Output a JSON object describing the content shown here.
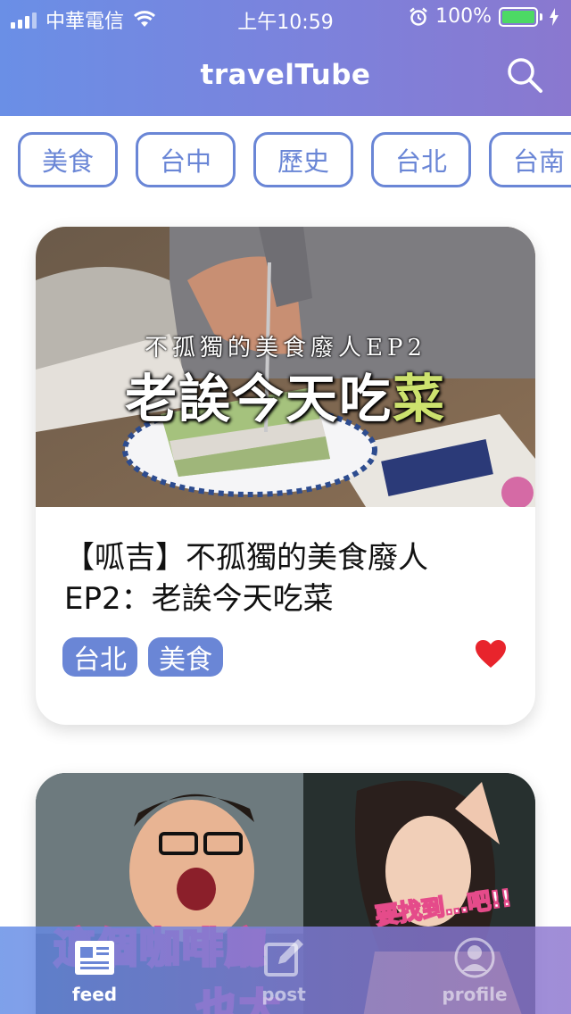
{
  "status_bar": {
    "carrier": "中華電信",
    "time": "上午10:59",
    "battery": "100%",
    "battery_level": 1.0
  },
  "header": {
    "title": "travelTube",
    "search_icon": "search-icon"
  },
  "chips": [
    {
      "label": "美食"
    },
    {
      "label": "台中"
    },
    {
      "label": "歷史"
    },
    {
      "label": "台北"
    },
    {
      "label": "台南"
    }
  ],
  "feed": [
    {
      "thumbnail_overline": "不孤獨的美食廢人EP2",
      "thumbnail_headline_a": "老誒今天吃",
      "thumbnail_headline_b": "菜",
      "title": "【呱吉】不孤獨的美食廢人EP2：老誒今天吃菜",
      "tags": [
        "台北",
        "美食"
      ],
      "liked": true
    },
    {
      "thumbnail_text_main": "這個咖啡廳",
      "thumbnail_text_side": "要找到…吧!!",
      "thumbnail_text_bottom": "也太"
    }
  ],
  "tabbar": {
    "tabs": [
      {
        "label": "feed",
        "icon": "newspaper-icon",
        "active": true
      },
      {
        "label": "post",
        "icon": "compose-icon",
        "active": false
      },
      {
        "label": "profile",
        "icon": "user-icon",
        "active": false
      }
    ]
  },
  "colors": {
    "accent": "#6a86d6",
    "header_start": "#6a8fe6",
    "header_end": "#8a78cf",
    "heart": "#e8242c",
    "battery_fill": "#4cd964"
  }
}
